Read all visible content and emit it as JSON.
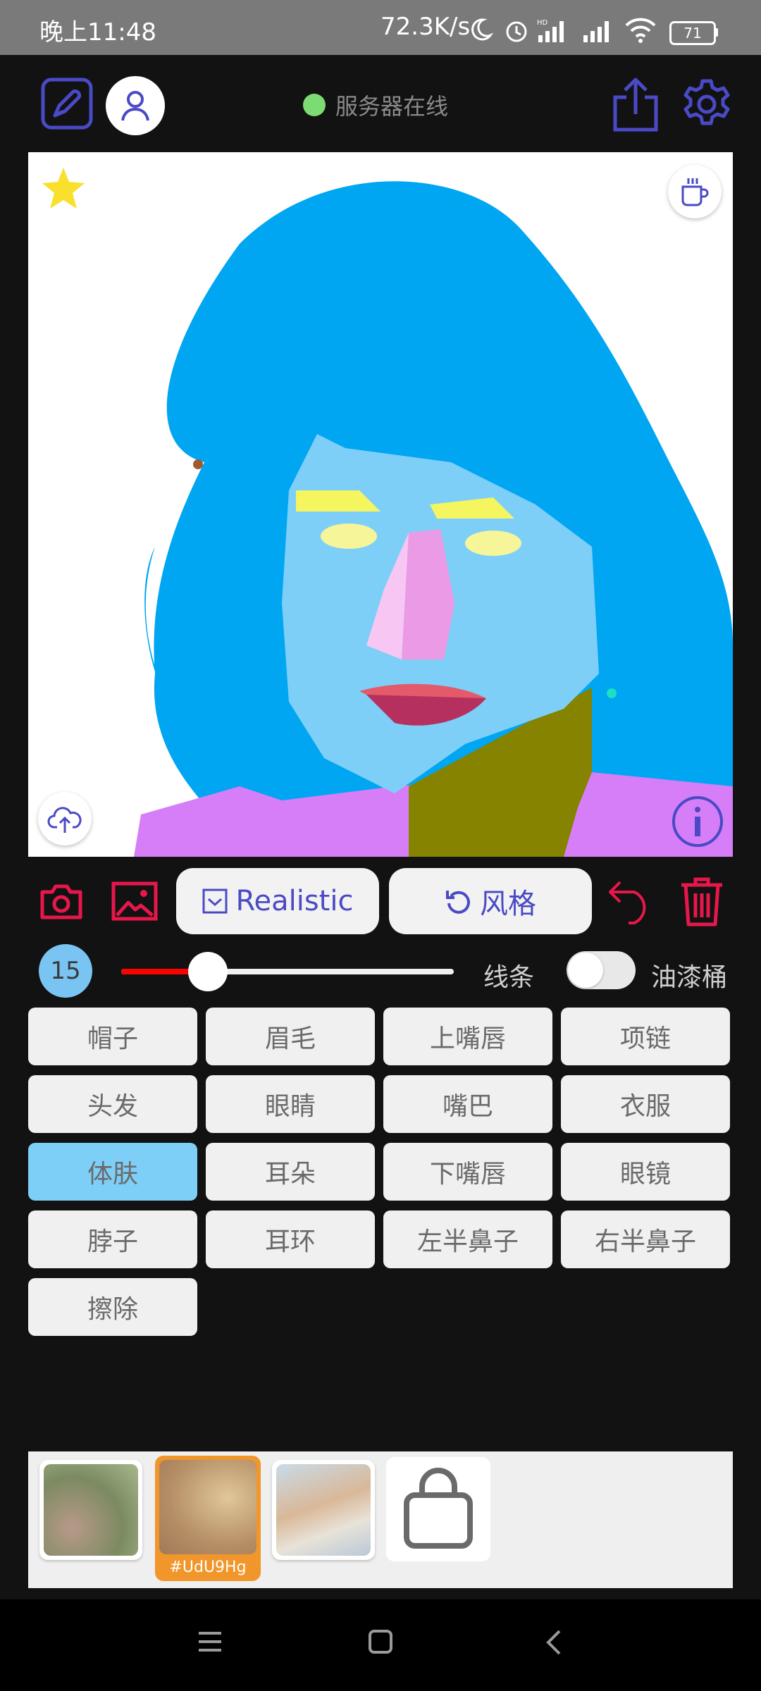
{
  "status_bar": {
    "time": "晚上11:48",
    "speed": "72.3K/s",
    "battery": "71",
    "icons": [
      "moon-icon",
      "alarm-icon",
      "hd-signal-icon",
      "signal-icon",
      "wifi-icon",
      "battery-icon"
    ]
  },
  "header": {
    "server_status": "服务器在线",
    "status_color": "#7ddb73",
    "icons": [
      "pen-edit-icon",
      "user-icon",
      "share-icon",
      "gear-icon"
    ]
  },
  "canvas": {
    "icons": [
      "star-icon",
      "coffee-cup-icon",
      "cloud-upload-icon",
      "info-icon"
    ]
  },
  "toolbar": {
    "realistic_label": "Realistic",
    "style_label": "风格",
    "accent_color": "#e8174b",
    "button_text_color": "#4a4ac6",
    "icons": [
      "camera-icon",
      "image-icon",
      "check-box-icon",
      "rotate-icon",
      "undo-icon",
      "trash-icon"
    ]
  },
  "brush": {
    "size": "15",
    "value": 0.26,
    "mode_label": "线条",
    "bucket_label": "油漆桶",
    "bucket_on": false
  },
  "labels": [
    {
      "text": "帽子",
      "active": false
    },
    {
      "text": "眉毛",
      "active": false
    },
    {
      "text": "上嘴唇",
      "active": false
    },
    {
      "text": "项链",
      "active": false
    },
    {
      "text": "头发",
      "active": false
    },
    {
      "text": "眼睛",
      "active": false
    },
    {
      "text": "嘴巴",
      "active": false
    },
    {
      "text": "衣服",
      "active": false
    },
    {
      "text": "体肤",
      "active": true
    },
    {
      "text": "耳朵",
      "active": false
    },
    {
      "text": "下嘴唇",
      "active": false
    },
    {
      "text": "眼镜",
      "active": false
    },
    {
      "text": "脖子",
      "active": false
    },
    {
      "text": "耳环",
      "active": false
    },
    {
      "text": "左半鼻子",
      "active": false
    },
    {
      "text": "右半鼻子",
      "active": false
    },
    {
      "text": "擦除",
      "active": false
    }
  ],
  "palette": {
    "selected_tag": "#UdU9Hg",
    "selected_color": "#f0962a",
    "icons": [
      "shopping-bag-icon"
    ]
  },
  "nav_bar": {
    "icons": [
      "menu-icon",
      "home-square-icon",
      "back-icon"
    ]
  }
}
